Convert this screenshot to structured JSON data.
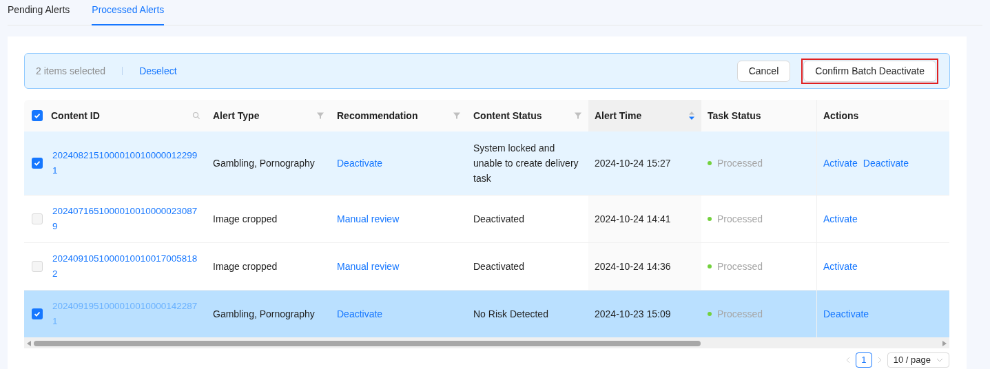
{
  "tabs": [
    {
      "label": "Pending Alerts",
      "selected": false
    },
    {
      "label": "Processed Alerts",
      "selected": true
    }
  ],
  "selection_bar": {
    "count_text": "2 items selected",
    "deselect": "Deselect",
    "buttons": [
      {
        "label": "Cancel",
        "highlighted": false
      },
      {
        "label": "Confirm Batch Deactivate",
        "highlighted": true
      }
    ]
  },
  "table": {
    "all_checked": true,
    "columns": [
      {
        "label": "Content ID",
        "kind": "search"
      },
      {
        "label": "Alert Type",
        "kind": "filter"
      },
      {
        "label": "Recommendation",
        "kind": "filter"
      },
      {
        "label": "Content Status",
        "kind": "filter"
      },
      {
        "label": "Alert Time",
        "kind": "sort"
      },
      {
        "label": "Task Status",
        "kind": "plain"
      },
      {
        "label": "Actions",
        "kind": "plain"
      }
    ],
    "rows": [
      {
        "selected": true,
        "hovered": false,
        "content_id": "20240821510000100100000122991",
        "alert_type": "Gambling, Pornography",
        "recommendation": "Deactivate",
        "content_status": "System locked and unable to create delivery task",
        "alert_time": "2024-10-24 15:27",
        "task_status": "Processed",
        "actions": [
          "Activate",
          "Deactivate"
        ]
      },
      {
        "selected": false,
        "hovered": false,
        "content_id": "20240716510000100100000230879",
        "alert_type": "Image cropped",
        "recommendation": "Manual review",
        "content_status": "Deactivated",
        "alert_time": "2024-10-24 14:41",
        "task_status": "Processed",
        "actions": [
          "Activate"
        ]
      },
      {
        "selected": false,
        "hovered": false,
        "content_id": "20240910510000100100170058182",
        "alert_type": "Image cropped",
        "recommendation": "Manual review",
        "content_status": "Deactivated",
        "alert_time": "2024-10-24 14:36",
        "task_status": "Processed",
        "actions": [
          "Activate"
        ]
      },
      {
        "selected": true,
        "hovered": true,
        "content_id": "20240919510000100100001422871",
        "alert_type": "Gambling, Pornography",
        "recommendation": "Deactivate",
        "content_status": "No Risk Detected",
        "alert_time": "2024-10-23 15:09",
        "task_status": "Processed",
        "actions": [
          "Deactivate"
        ]
      }
    ]
  },
  "pagination": {
    "current_page": "1",
    "page_size": "10 / page"
  }
}
